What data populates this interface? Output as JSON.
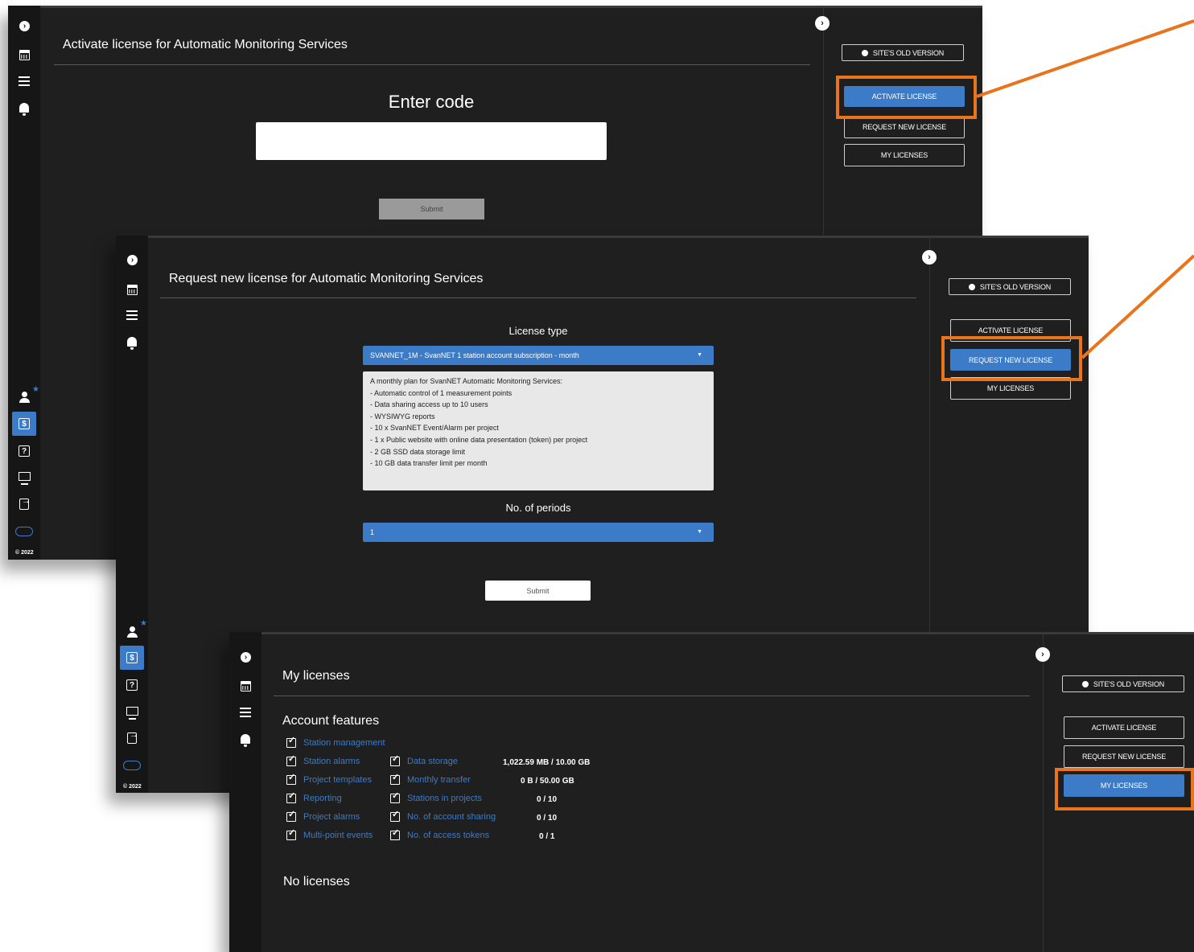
{
  "colors": {
    "accent": "#3c7bc7",
    "highlight": "#e8741d",
    "panel": "#1f1f1f",
    "sidebar": "#161616"
  },
  "nav": {
    "copyright": "© 2022"
  },
  "right_menu": {
    "old_version": "SITE'S OLD VERSION",
    "activate": "ACTIVATE LICENSE",
    "request": "REQUEST NEW LICENSE",
    "my_licenses": "MY LICENSES"
  },
  "win1": {
    "title": "Activate license for Automatic Monitoring Services",
    "heading": "Enter code",
    "code_value": "",
    "submit": "Submit"
  },
  "win2": {
    "title": "Request new license for Automatic Monitoring Services",
    "license_type_label": "License type",
    "license_type_value": "SVANNET_1M - SvanNET 1 station account subscription - month",
    "description": [
      "A monthly plan for SvanNET Automatic Monitoring Services:",
      "- Automatic control of 1 measurement points",
      "- Data sharing access up to 10 users",
      "- WYSIWYG reports",
      "- 10 x SvanNET Event/Alarm per project",
      "- 1 x Public website with online data presentation (token) per project",
      "- 2 GB SSD data storage limit",
      "- 10 GB data transfer limit per month"
    ],
    "periods_label": "No. of periods",
    "periods_value": "1",
    "submit": "Submit"
  },
  "win3": {
    "title": "My licenses",
    "features_heading": "Account features",
    "features_col1": [
      "Station management",
      "Station alarms",
      "Project templates",
      "Reporting",
      "Project alarms",
      "Multi-point events"
    ],
    "features_col2": [
      {
        "label": "Data storage",
        "value": "1,022.59 MB / 10.00 GB"
      },
      {
        "label": "Monthly transfer",
        "value": "0 B / 50.00 GB"
      },
      {
        "label": "Stations in projects",
        "value": "0 / 10"
      },
      {
        "label": "No. of account sharing",
        "value": "0 / 10"
      },
      {
        "label": "No. of access tokens",
        "value": "0 / 1"
      }
    ],
    "no_licenses": "No licenses"
  }
}
